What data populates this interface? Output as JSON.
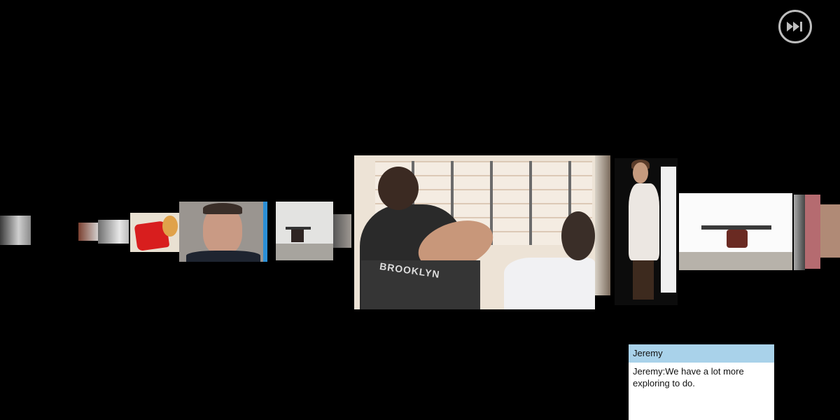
{
  "toolbar": {
    "skip_icon": "fast-forward-skip-icon",
    "skip_icon_color": "#bdbdbd"
  },
  "carousel": {
    "tiles": [
      {
        "name": "thumb-far-left"
      },
      {
        "name": "thumb-small-1"
      },
      {
        "name": "thumb-small-2"
      },
      {
        "name": "thumb-red-fabric"
      },
      {
        "name": "thumb-man-face"
      },
      {
        "name": "thumb-drone-small"
      },
      {
        "name": "thumb-sliver"
      },
      {
        "name": "video-main"
      },
      {
        "name": "thumb-woman"
      },
      {
        "name": "thumb-drone-large"
      },
      {
        "name": "thumb-right-edge"
      }
    ]
  },
  "chat": {
    "header_color": "#a9d2ea",
    "username": "Jeremy",
    "message": "Jeremy:We have a lot more exploring to do."
  },
  "main_video": {
    "shirt_text": "BROOKLYN"
  }
}
